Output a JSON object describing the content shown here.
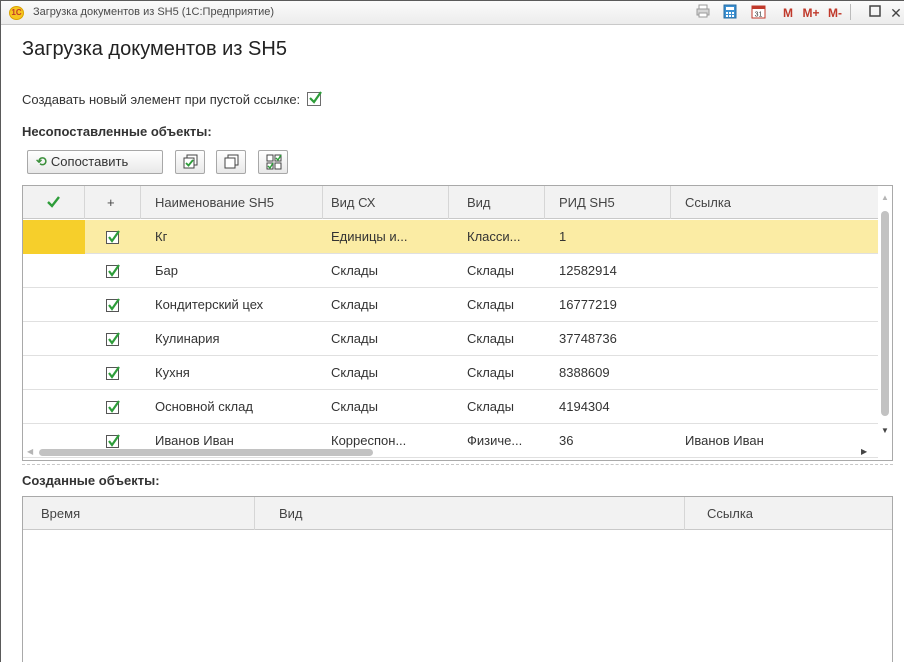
{
  "window": {
    "title": "Загрузка документов из SH5  (1С:Предприятие)",
    "logo": "1С",
    "buttons": [
      "M",
      "M+",
      "M-"
    ]
  },
  "heading": "Загрузка документов из SH5",
  "option": {
    "label": "Создавать новый элемент при пустой ссылке:",
    "checked": true
  },
  "unmatched": {
    "title": "Несопоставленные объекты:",
    "toolbar": {
      "match_label": "Сопоставить"
    },
    "columns": [
      "Наименование SH5",
      "Вид СХ",
      "Вид",
      "РИД SH5",
      "Ссылка"
    ],
    "plus_header": "+",
    "rows": [
      {
        "name": "Кг",
        "vid_sx": "Единицы и...",
        "vid": "Класси...",
        "rid": "1",
        "link": "",
        "checked": true,
        "selected": true
      },
      {
        "name": "Бар",
        "vid_sx": "Склады",
        "vid": "Склады",
        "rid": "12582914",
        "link": "",
        "checked": true,
        "selected": false
      },
      {
        "name": "Кондитерский цех",
        "vid_sx": "Склады",
        "vid": "Склады",
        "rid": "16777219",
        "link": "",
        "checked": true,
        "selected": false
      },
      {
        "name": "Кулинария",
        "vid_sx": "Склады",
        "vid": "Склады",
        "rid": "37748736",
        "link": "",
        "checked": true,
        "selected": false
      },
      {
        "name": "Кухня",
        "vid_sx": "Склады",
        "vid": "Склады",
        "rid": "8388609",
        "link": "",
        "checked": true,
        "selected": false
      },
      {
        "name": "Основной склад",
        "vid_sx": "Склады",
        "vid": "Склады",
        "rid": "4194304",
        "link": "",
        "checked": true,
        "selected": false
      },
      {
        "name": "Иванов Иван",
        "vid_sx": "Корреспон...",
        "vid": "Физиче...",
        "rid": "36",
        "link": "Иванов Иван",
        "checked": true,
        "selected": false
      }
    ]
  },
  "created": {
    "title": "Созданные объекты:",
    "columns": [
      "Время",
      "Вид",
      "Ссылка"
    ]
  },
  "colors": {
    "selected_row": "#fbeca4",
    "check_green": "#2e9d3a"
  }
}
